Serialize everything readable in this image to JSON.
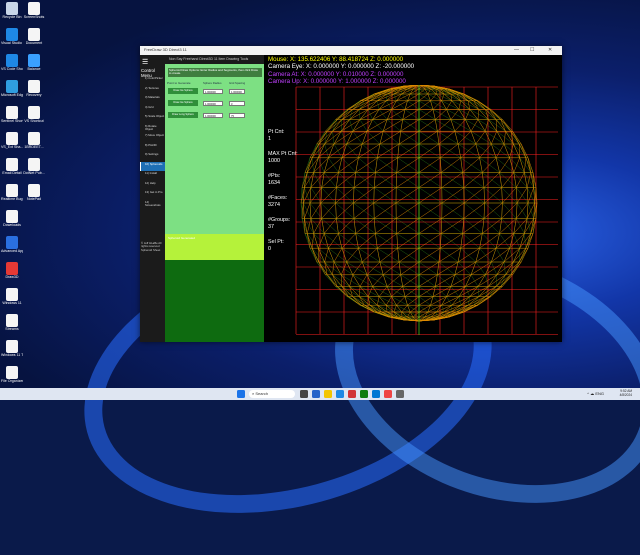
{
  "desktop": {
    "icons": [
      {
        "label": "Recycle Bin",
        "color": "#c9d6e8",
        "col": 0,
        "row": 0
      },
      {
        "label": "ScreenShots",
        "color": "#f5f5f5",
        "col": 1,
        "row": 0
      },
      {
        "label": "Visual Studio Code",
        "color": "#1e88e5",
        "col": 0,
        "row": 1
      },
      {
        "label": "Document",
        "color": "#f5f5f5",
        "col": 1,
        "row": 1
      },
      {
        "label": "VS Code Shortcut",
        "color": "#1e88e5",
        "col": 0,
        "row": 2
      },
      {
        "label": "Balance",
        "color": "#3aa0ff",
        "col": 1,
        "row": 2
      },
      {
        "label": "Microsoft Edge",
        "color": "#2f9de0",
        "col": 0,
        "row": 3
      },
      {
        "label": "Recovery",
        "color": "#f5f5f5",
        "col": 1,
        "row": 3
      },
      {
        "label": "Sentinel Shortcut",
        "color": "#f5f5f5",
        "col": 0,
        "row": 4
      },
      {
        "label": "VS Shortcut",
        "color": "#f5f5f5",
        "col": 1,
        "row": 4
      },
      {
        "label": "VS_Ext Sha...",
        "color": "#f5f5f5",
        "col": 0,
        "row": 5
      },
      {
        "label": "1BRDEET...",
        "color": "#f5f5f5",
        "col": 1,
        "row": 5
      },
      {
        "label": "Email Detail",
        "color": "#f5f5f5",
        "col": 0,
        "row": 6
      },
      {
        "label": "DotNet Pub...",
        "color": "#f5f5f5",
        "col": 1,
        "row": 6
      },
      {
        "label": "Realtime Bug Lst",
        "color": "#f5f5f5",
        "col": 0,
        "row": 7
      },
      {
        "label": "NotePad",
        "color": "#f5f5f5",
        "col": 1,
        "row": 7
      },
      {
        "label": "Downloads",
        "color": "#f5f5f5",
        "col": 0,
        "row": 8
      },
      {
        "label": "Advanced Apps",
        "color": "#2a6fe0",
        "col": 0,
        "row": 9
      },
      {
        "label": "Draw3D",
        "color": "#e53935",
        "col": 0,
        "row": 10
      },
      {
        "label": "Windows 11",
        "color": "#f5f5f5",
        "col": 0,
        "row": 11
      },
      {
        "label": "Streams",
        "color": "#f5f5f5",
        "col": 0,
        "row": 12
      },
      {
        "label": "Windows 11 Troubleshoot",
        "color": "#f5f5f5",
        "col": 0,
        "row": 13
      },
      {
        "label": "File Organizer",
        "color": "#f5f5f5",
        "col": 0,
        "row": 14
      }
    ]
  },
  "window": {
    "title": "FreeDraw 3D Direct3 11",
    "min": "—",
    "max": "☐",
    "close": "✕"
  },
  "nav": {
    "title": "Control Menu",
    "items": [
      "1) ColorPicker",
      "2) Textures",
      "3) Materials",
      "4) Grid",
      "5) Scale Object",
      "6) Rotate Object",
      "7) Move Object",
      "8) Plot3D",
      "9) Settings",
      "10) Spheroids",
      "11) Install",
      "12) Help",
      "13) Get in Pro",
      "14) Screenshots"
    ],
    "selected_index": 9,
    "copyright": "© Jeff HLaBe All rights reserved",
    "extra": "Spheroid Sheet"
  },
  "panel": {
    "title": "Non Say Freehand Direct3D 11 Item Drawing Tools",
    "description": "Spheroid Draw Options: Enter Radius and Segments, then click Draw to create.",
    "group_label": "Point to Generate",
    "col_header_radius": "Sphere Radius",
    "col_header_spacing": "Grid Spacing",
    "rows": [
      {
        "button": "Draw Ice Sphere",
        "value1": "1.000000",
        "value2": "1.000000"
      },
      {
        "button": "Draw Ice Sphere",
        "value1": "1.000000",
        "value2": "3"
      },
      {
        "button": "Draw Long Sphere",
        "value1": "1.000000",
        "value2": "75"
      }
    ],
    "status_label": "Spheroid Generated"
  },
  "viewport": {
    "mouse": "Mouse:  X: 135.622406 Y: 88.418724 Z: 0.000000",
    "camera_eye": "Camera Eye:  X: 0.000000 Y: 0.000000 Z: -20.000000",
    "camera_at": "Camera At:  X: 0.000000 Y: 0.010000 Z: 0.000000",
    "camera_up": "Camera Up:  X: 0.000000 Y: 1.000000 Z: 0.000000",
    "stats": [
      {
        "label": "Pt Cnt:",
        "value": "1"
      },
      {
        "label": "MAX Pt Cnt:",
        "value": "1000"
      },
      {
        "label": "#Pts:",
        "value": "1634"
      },
      {
        "label": "#Faces:",
        "value": "3274"
      },
      {
        "label": "#Groups:",
        "value": "37"
      },
      {
        "label": "Sel Pt:",
        "value": "0"
      }
    ],
    "colors": {
      "mouse": "#ffff00",
      "eye": "#ffffff",
      "at": "#c040ff",
      "up": "#c040ff",
      "grid": "#ff2020",
      "sphere_outer": "#e08a00",
      "sphere_inner": "#40c020"
    }
  },
  "taskbar": {
    "search_placeholder": "Search",
    "time": "9:52 AM",
    "date": "4/8/2024",
    "tray": "^  ☁  ENG"
  }
}
